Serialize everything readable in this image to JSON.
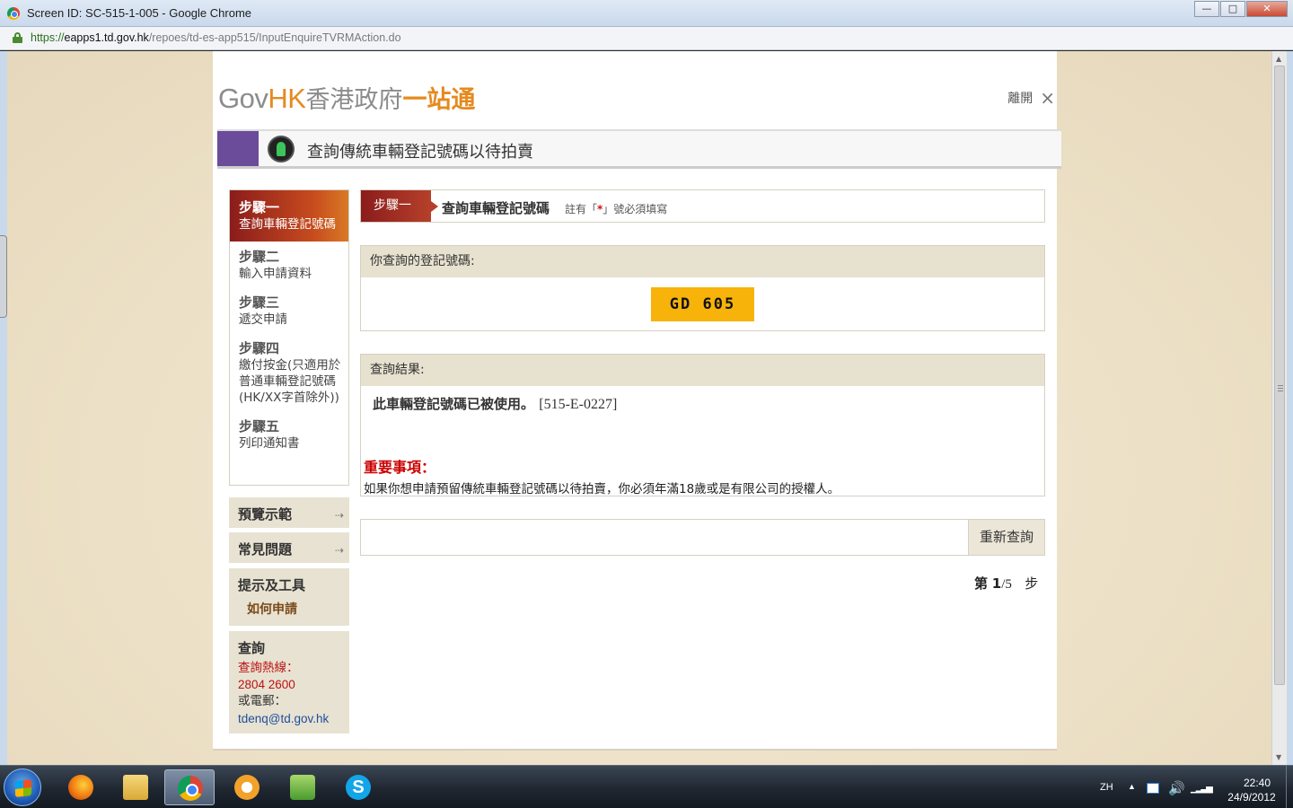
{
  "browser": {
    "window_title": "Screen ID: SC-515-1-005 - Google Chrome",
    "url_scheme": "https://",
    "url_host": "eapps1.td.gov.hk",
    "url_path": "/repoes/td-es-app515/InputEnquireTVRMAction.do",
    "minimize_glyph": "—",
    "maximize_glyph": "□",
    "close_glyph": "✕"
  },
  "header": {
    "logo_gov": "Gov",
    "logo_hk": "HK",
    "logo_zh": "香港政府",
    "logo_zh_accent": "一站通",
    "leave_label": "離開",
    "leave_glyph": "×"
  },
  "banner": {
    "title": "查詢傳統車輛登記號碼以待拍賣"
  },
  "steps": [
    {
      "name": "步驟一",
      "desc": "查詢車輛登記號碼"
    },
    {
      "name": "步驟二",
      "desc": "輸入申請資料"
    },
    {
      "name": "步驟三",
      "desc": "遞交申請"
    },
    {
      "name": "步驟四",
      "desc": "繳付按金(只適用於普通車輛登記號碼(HK/XX字首除外))"
    },
    {
      "name": "步驟五",
      "desc": "列印通知書"
    }
  ],
  "sidebar": {
    "preview_label": "預覽示範",
    "faq_label": "常見問題",
    "arrow_glyph": "⇢",
    "tips_label": "提示及工具",
    "howto_label": "如何申請",
    "inquiry_label": "查詢",
    "hotline_label": "查詢熱線：",
    "hotline_number": "2804 2600",
    "email_label": "或電郵：",
    "email": "tdenq@td.gov.hk"
  },
  "main": {
    "step_tag": "步驟一",
    "step_heading": "查詢車輛登記號碼",
    "note_prefix": "註有「",
    "note_req": "*",
    "note_suffix": "」號必須填寫",
    "plate_panel_label": "你查詢的登記號碼:",
    "plate": "GD 605",
    "result_panel_label": "查詢結果:",
    "result_message": "此車輛登記號碼已被使用。",
    "result_code": "[515-E-0227]",
    "important_title": "重要事項：",
    "important_text": "如果你想申請預留傳統車輛登記號碼以待拍賣，你必須年滿18歲或是有限公司的授權人。",
    "requery_button": "重新查詢",
    "pager_prefix": "第",
    "pager_current": "1",
    "pager_total": "/5",
    "pager_suffix": "步"
  },
  "taskbar": {
    "lang": "ZH",
    "time": "22:40",
    "date": "24/9/2012",
    "skype_glyph": "S",
    "tray_up_glyph": "▲",
    "volume_glyph": "🔊",
    "signal_glyph": "▁▂▃▅"
  },
  "colors": {
    "accent_red": "#8b1c1c",
    "accent_orange": "#e58a1f",
    "plate_yellow": "#f7b30a",
    "purple": "#6b4c9a",
    "panel_beige": "#e7e1cf"
  }
}
